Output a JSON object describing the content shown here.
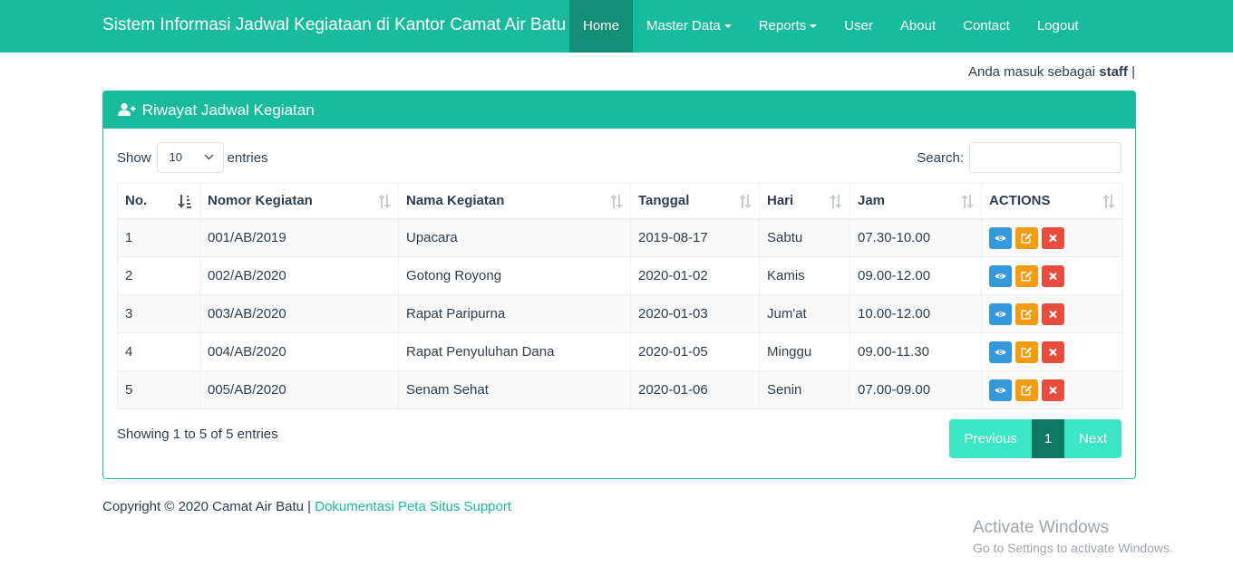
{
  "app": {
    "brand": "Sistem Informasi Jadwal Kegiataan di Kantor Camat Air Batu"
  },
  "nav": {
    "home": "Home",
    "master_data": "Master Data",
    "reports": "Reports",
    "user": "User",
    "about": "About",
    "contact": "Contact",
    "logout": "Logout"
  },
  "login": {
    "prefix": "Anda masuk sebagai",
    "role": "staff",
    "suffix": "|"
  },
  "panel": {
    "title": "Riwayat Jadwal Kegiatan"
  },
  "length": {
    "show": "Show",
    "value": "10",
    "entries": "entries"
  },
  "search": {
    "label": "Search:",
    "value": ""
  },
  "table": {
    "headers": [
      "No.",
      "Nomor Kegiatan",
      "Nama Kegiatan",
      "Tanggal",
      "Hari",
      "Jam",
      "ACTIONS"
    ],
    "rows": [
      [
        "1",
        "001/AB/2019",
        "Upacara",
        "2019-08-17",
        "Sabtu",
        "07.30-10.00"
      ],
      [
        "2",
        "002/AB/2020",
        "Gotong Royong",
        "2020-01-02",
        "Kamis",
        "09.00-12.00"
      ],
      [
        "3",
        "003/AB/2020",
        "Rapat Paripurna",
        "2020-01-03",
        "Jum'at",
        "10.00-12.00"
      ],
      [
        "4",
        "004/AB/2020",
        "Rapat Penyuluhan Dana",
        "2020-01-05",
        "Minggu",
        "09.00-11.30"
      ],
      [
        "5",
        "005/AB/2020",
        "Senam Sehat",
        "2020-01-06",
        "Senin",
        "07.00-09.00"
      ]
    ]
  },
  "info": "Showing 1 to 5 of 5 entries",
  "pagination": {
    "previous": "Previous",
    "page": "1",
    "next": "Next"
  },
  "footer": {
    "copyright": "Copyright © 2020 Camat Air Batu |",
    "links": "Dokumentasi Peta Situs Support"
  },
  "watermark": {
    "title": "Activate Windows",
    "subtitle": "Go to Settings to activate Windows."
  },
  "colors": {
    "primary": "#18bc9c",
    "view": "#3498db",
    "edit": "#f39c12",
    "delete": "#e74c3c",
    "active_page": "#0f7864"
  },
  "icons": {
    "panel": "user-plus-icon",
    "view": "eye-icon",
    "edit": "edit-icon",
    "delete": "close-icon",
    "sort": "sort-icon"
  }
}
